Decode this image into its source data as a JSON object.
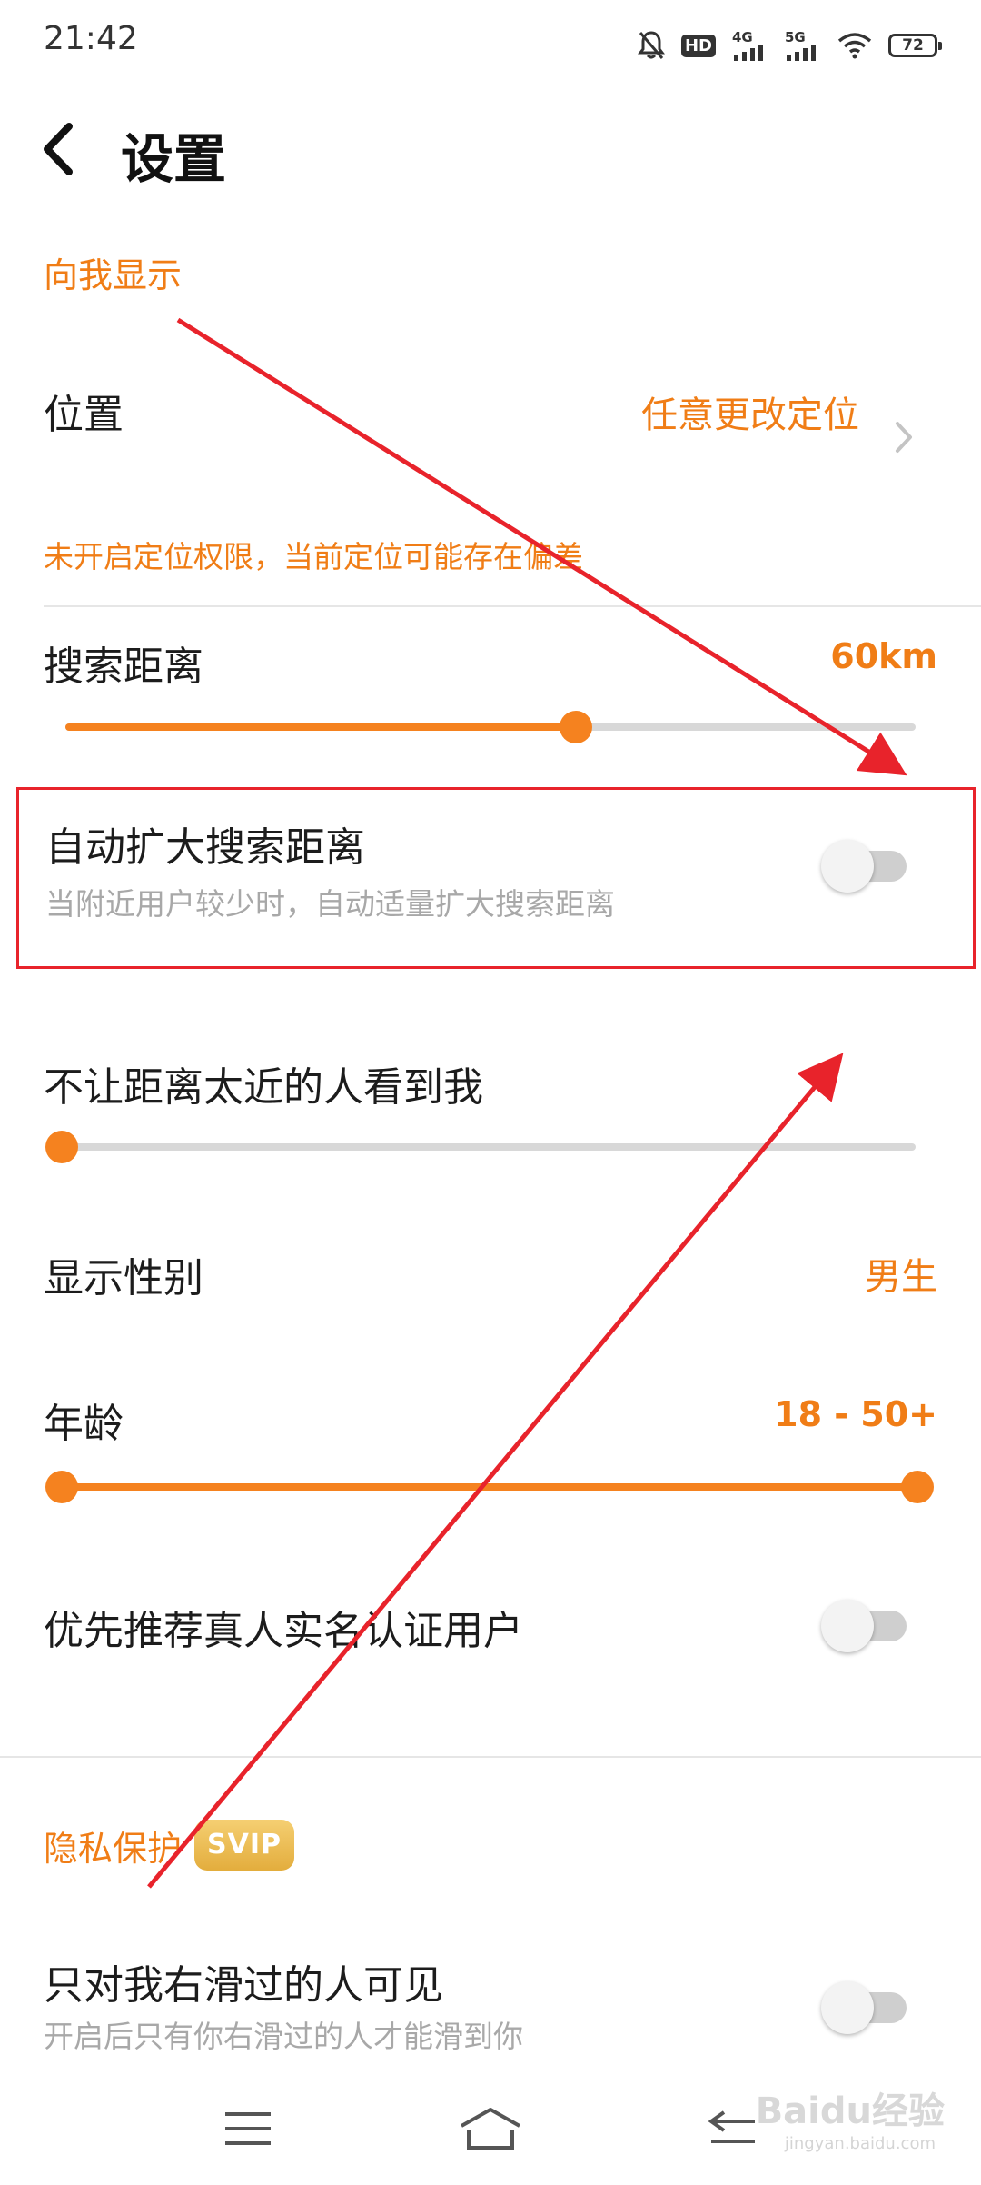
{
  "status_bar": {
    "time": "21:42",
    "network_1": "4G",
    "network_2": "5G",
    "battery": "72",
    "hd_label": "HD"
  },
  "header": {
    "title": "设置"
  },
  "section_show_me": {
    "title": "向我显示",
    "location": {
      "label": "位置",
      "value": "任意更改定位"
    },
    "location_warning": "未开启定位权限，当前定位可能存在偏差",
    "search_distance": {
      "label": "搜索距离",
      "value": "60km",
      "fraction": 0.6
    },
    "auto_expand": {
      "label": "自动扩大搜索距离",
      "description": "当附近用户较少时，自动适量扩大搜索距离",
      "enabled": false
    },
    "hide_near": {
      "label": "不让距离太近的人看到我",
      "fraction": 0.0
    },
    "gender": {
      "label": "显示性别",
      "value": "男生"
    },
    "age": {
      "label": "年龄",
      "value": "18 - 50+",
      "min_fraction": 0.0,
      "max_fraction": 1.0
    },
    "verified_first": {
      "label": "优先推荐真人实名认证用户",
      "enabled": false
    }
  },
  "section_privacy": {
    "title": "隐私保护",
    "badge": "SVIP",
    "right_swiped_only": {
      "label": "只对我右滑过的人可见",
      "description": "开启后只有你右滑过的人才能滑到你",
      "enabled": false
    }
  },
  "watermark": {
    "brand": "Baidu经验",
    "url": "jingyan.baidu.com"
  },
  "colors": {
    "accent": "#f5821f",
    "annotation_red": "#e8232b"
  }
}
